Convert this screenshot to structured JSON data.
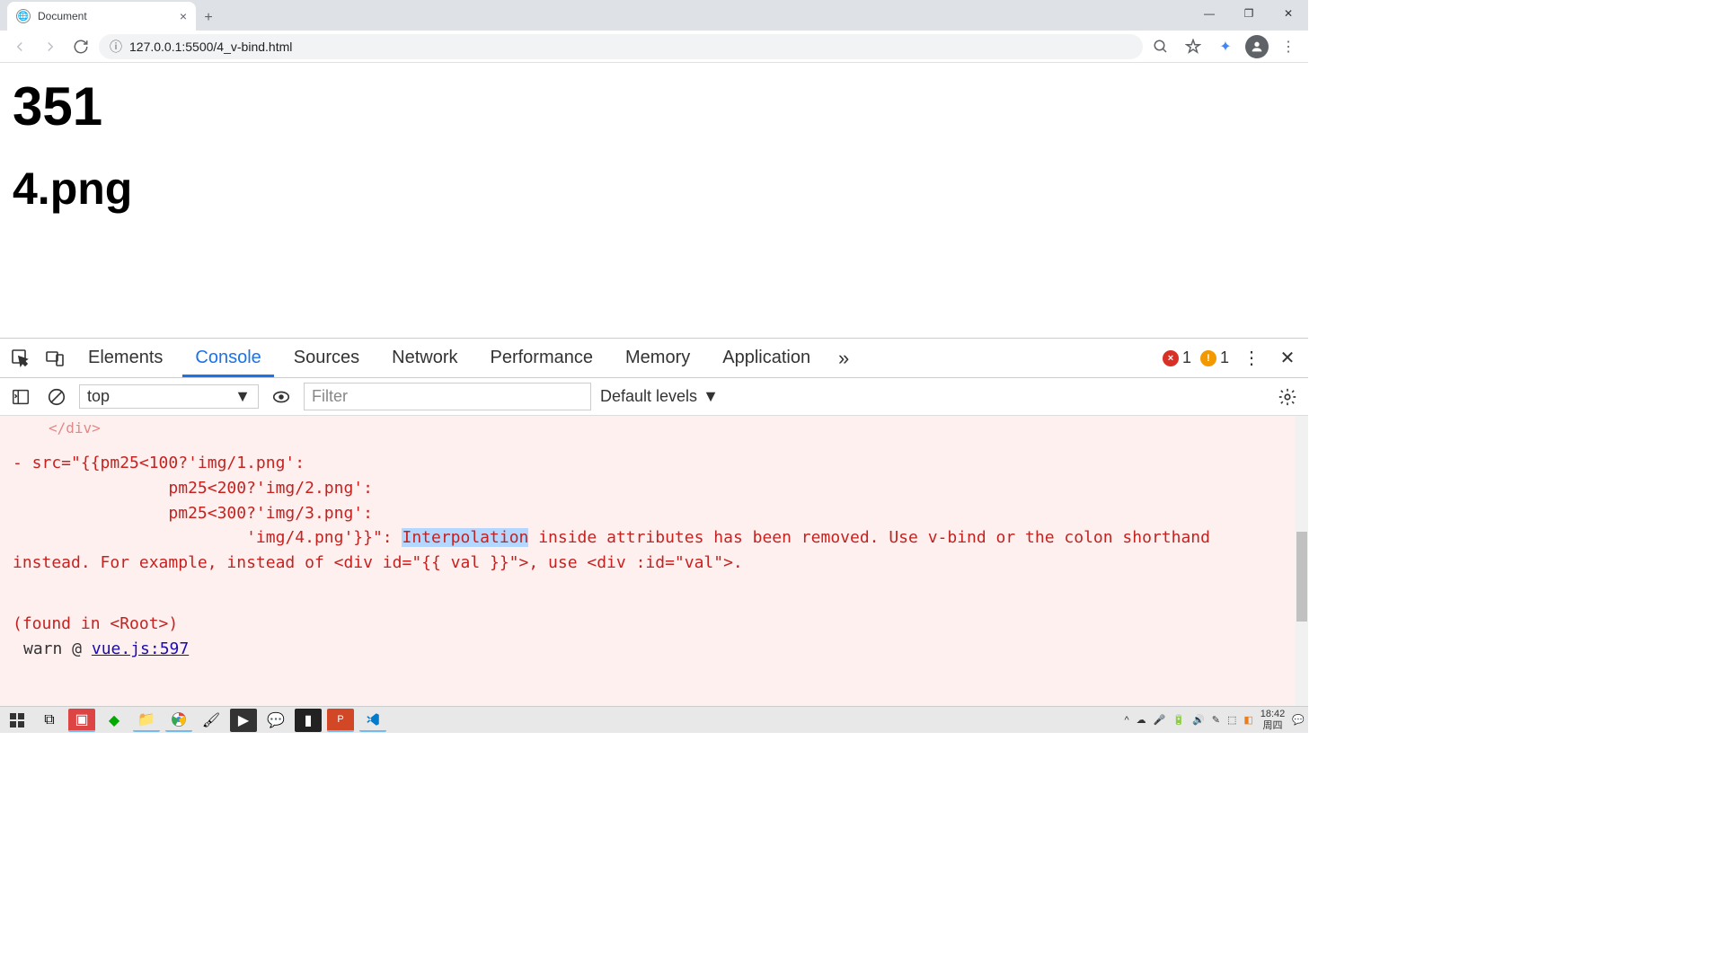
{
  "browser": {
    "tab_title": "Document",
    "url": "127.0.0.1:5500/4_v-bind.html"
  },
  "page": {
    "heading1": "351",
    "heading2": "4.png"
  },
  "devtools": {
    "tabs": [
      "Elements",
      "Console",
      "Sources",
      "Network",
      "Performance",
      "Memory",
      "Application"
    ],
    "active_tab": "Console",
    "error_count": "1",
    "warning_count": "1",
    "context": "top",
    "filter_placeholder": "Filter",
    "levels": "Default levels",
    "console": {
      "partial_close": "</div>",
      "line1": "- src=\"{{pm25<100?'img/1.png':",
      "line2": "                pm25<200?'img/2.png':",
      "line3": "                pm25<300?'img/3.png':",
      "line4_a": "                        'img/4.png'}}\": ",
      "line4_hl": "Interpolation",
      "line4_b": " inside attributes has been removed. Use v-bind or the colon shorthand instead. For example, instead of <div id=\"{{ val }}\">, use <div :id=\"val\">.",
      "found": "(found in <Root>)",
      "warn_prefix": "warn @ ",
      "warn_link": "vue.js:597"
    }
  },
  "taskbar": {
    "time": "18:42",
    "date": "周四"
  }
}
